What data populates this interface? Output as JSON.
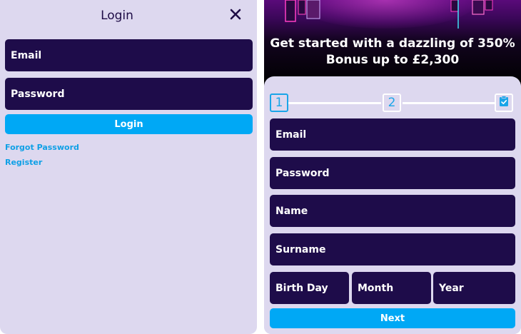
{
  "login_panel": {
    "title": "Login",
    "email_placeholder": "Email",
    "password_placeholder": "Password",
    "login_button": "Login",
    "forgot_password_link": "Forgot Password",
    "register_link": "Register",
    "close_icon": "close-icon"
  },
  "register_panel": {
    "hero_line1": "Get started with a dazzling of 350%",
    "hero_line2": "Bonus up to £2,300",
    "steps": [
      "1",
      "2"
    ],
    "final_step_icon": "clipboard-check-icon",
    "fields": {
      "email": "Email",
      "password": "Password",
      "name": "Name",
      "surname": "Surname",
      "birth_day": "Birth Day",
      "month": "Month",
      "year": "Year"
    },
    "next_button": "Next"
  },
  "colors": {
    "panel_bg": "#ddd8ef",
    "field_bg": "#1e0c4a",
    "accent": "#00a8f5"
  }
}
